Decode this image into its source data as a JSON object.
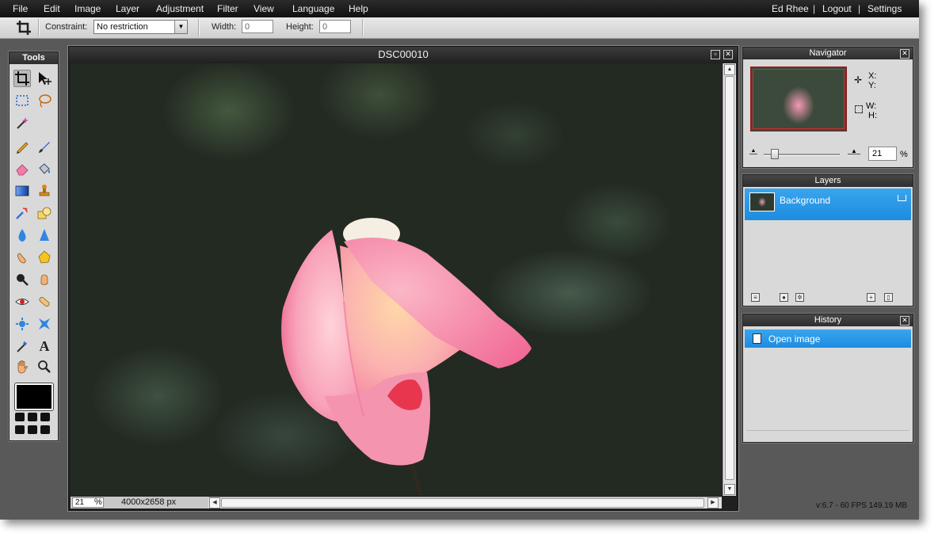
{
  "menu": {
    "items": [
      "File",
      "Edit",
      "Image",
      "Layer",
      "Adjustment",
      "Filter",
      "View",
      "Language",
      "Help"
    ],
    "user": "Ed Rhee",
    "logout": "Logout",
    "settings": "Settings",
    "separator": "|"
  },
  "options": {
    "constraint_label": "Constraint:",
    "constraint_value": "No restriction",
    "width_label": "Width:",
    "width_value": "0",
    "height_label": "Height:",
    "height_value": "0"
  },
  "tools_panel": {
    "title": "Tools",
    "icons": [
      "crop-icon",
      "move-icon",
      "marquee-icon",
      "lasso-icon",
      "magic-wand-icon",
      "pencil-icon",
      "brush-icon",
      "eraser-icon",
      "bucket-icon",
      "gradient-icon",
      "clone-stamp-icon",
      "color-replace-icon",
      "shape-icon",
      "blur-icon",
      "sharpen-icon",
      "smudge-icon",
      "sponge-icon",
      "dodge-icon",
      "burn-icon",
      "red-eye-icon",
      "spot-heal-icon",
      "bloat-icon",
      "pinch-icon",
      "color-picker-icon",
      "type-icon",
      "hand-icon",
      "zoom-icon"
    ],
    "type_glyph": "A",
    "foreground_color": "#000000",
    "background_color": "#000000"
  },
  "image_window": {
    "title": "DSC00010",
    "zoom": "21",
    "zoom_unit": "%",
    "dimensions": "4000x2658 px"
  },
  "navigator": {
    "title": "Navigator",
    "x_label": "X:",
    "y_label": "Y:",
    "w_label": "W:",
    "h_label": "H:",
    "zoom_value": "21",
    "zoom_unit": "%",
    "zoom_level": 0.21
  },
  "layers": {
    "title": "Layers",
    "items": [
      {
        "name": "Background",
        "locked": true,
        "selected": true
      }
    ]
  },
  "history": {
    "title": "History",
    "items": [
      {
        "name": "Open image",
        "selected": true
      }
    ]
  },
  "status": {
    "text": "v:6.7 - 60 FPS 149.19 MB"
  },
  "colors": {
    "selection": "#2a9be8",
    "panel_bg": "#d9d9d9",
    "app_bg": "#595959",
    "menubar_bg": "#1c1c1c"
  }
}
